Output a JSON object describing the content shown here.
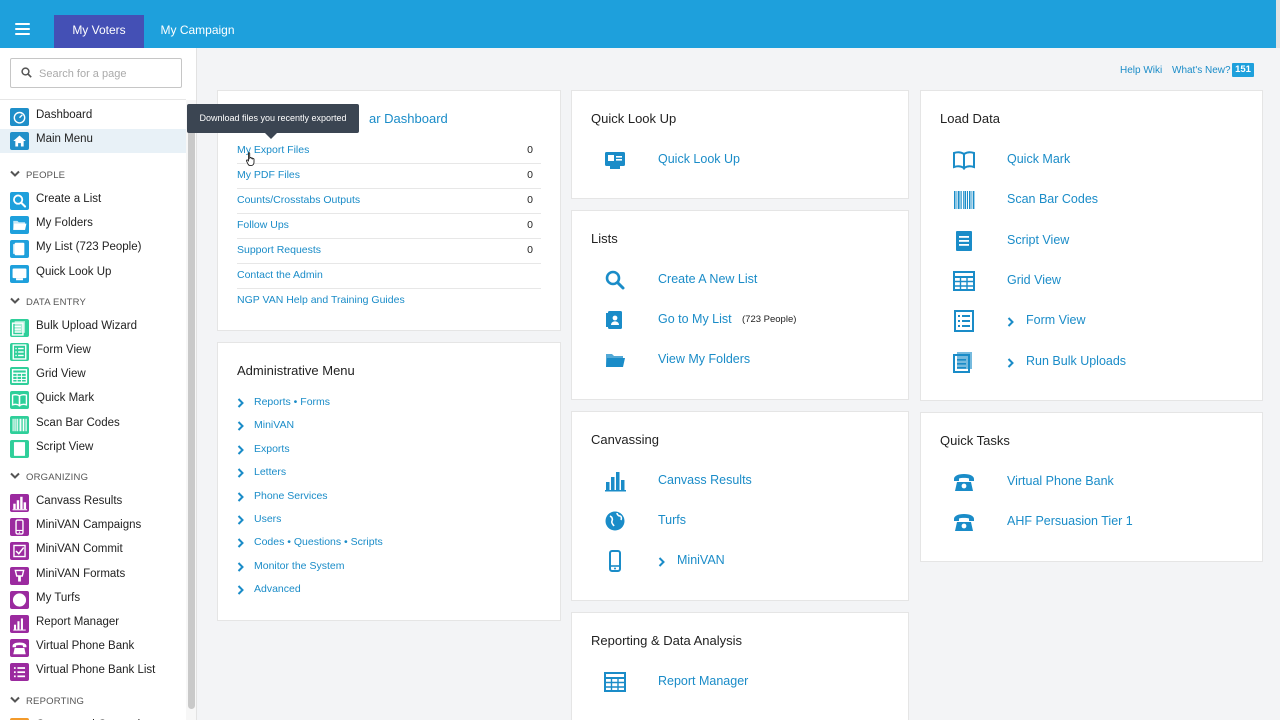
{
  "topbar": {
    "tabs": [
      {
        "label": "My Voters",
        "active": true
      },
      {
        "label": "My Campaign",
        "active": false
      }
    ],
    "colors": {
      "bar": "#1ea0dc",
      "active_tab": "#4450b5"
    }
  },
  "sidebar": {
    "search_placeholder": "Search for a page",
    "top_items": [
      {
        "label": "Dashboard",
        "icon": "dashboard-icon",
        "color": "#1f8fc9"
      },
      {
        "label": "Main Menu",
        "icon": "home-icon",
        "color": "#1f8fc9",
        "selected": true
      }
    ],
    "sections": [
      {
        "title": "PEOPLE",
        "color": "#1ea0dc",
        "items": [
          {
            "label": "Create a List",
            "icon": "search-icon"
          },
          {
            "label": "My Folders",
            "icon": "folder-icon"
          },
          {
            "label": "My List (723 People)",
            "icon": "contact-list-icon"
          },
          {
            "label": "Quick Look Up",
            "icon": "id-card-icon"
          }
        ]
      },
      {
        "title": "DATA ENTRY",
        "color": "#2fcf9a",
        "items": [
          {
            "label": "Bulk Upload Wizard",
            "icon": "bulk-upload-icon"
          },
          {
            "label": "Form View",
            "icon": "form-icon"
          },
          {
            "label": "Grid View",
            "icon": "grid-icon"
          },
          {
            "label": "Quick Mark",
            "icon": "book-icon"
          },
          {
            "label": "Scan Bar Codes",
            "icon": "barcode-icon"
          },
          {
            "label": "Script View",
            "icon": "script-icon"
          }
        ]
      },
      {
        "title": "ORGANIZING",
        "color": "#9b2a9f",
        "items": [
          {
            "label": "Canvass Results",
            "icon": "bar-chart-icon"
          },
          {
            "label": "MiniVAN Campaigns",
            "icon": "phone-device-icon"
          },
          {
            "label": "MiniVAN Commit",
            "icon": "checkbox-icon"
          },
          {
            "label": "MiniVAN Formats",
            "icon": "format-icon"
          },
          {
            "label": "My Turfs",
            "icon": "globe-icon"
          },
          {
            "label": "Report Manager",
            "icon": "report-icon"
          },
          {
            "label": "Virtual Phone Bank",
            "icon": "telephone-icon"
          },
          {
            "label": "Virtual Phone Bank List",
            "icon": "list-icon"
          }
        ]
      },
      {
        "title": "REPORTING",
        "color": "#f39a2a",
        "items": [
          {
            "label": "Counts and Crosstabs",
            "icon": "counts-icon"
          }
        ]
      }
    ]
  },
  "help": {
    "wiki": "Help Wiki",
    "whats_new": "What's New?",
    "badge": "151"
  },
  "dashboard": {
    "title_tail": "ar Dashboard",
    "tooltip": "Download files you recently exported",
    "rows": [
      {
        "label": "My Export Files",
        "count": "0"
      },
      {
        "label": "My PDF Files",
        "count": "0"
      },
      {
        "label": "Counts/Crosstabs Outputs",
        "count": "0"
      },
      {
        "label": "Follow Ups",
        "count": "0"
      },
      {
        "label": "Support Requests",
        "count": "0"
      },
      {
        "label": "Contact the Admin",
        "count": ""
      },
      {
        "label": "NGP VAN Help and Training Guides",
        "count": ""
      }
    ]
  },
  "admin": {
    "title": "Administrative Menu",
    "links": [
      "Reports • Forms",
      "MiniVAN",
      "Exports",
      "Letters",
      "Phone Services",
      "Users",
      "Codes • Questions • Scripts",
      "Monitor the System",
      "Advanced"
    ]
  },
  "quick_lookup": {
    "title": "Quick Look Up",
    "actions": [
      {
        "label": "Quick Look Up",
        "icon": "id-card-icon"
      }
    ]
  },
  "lists": {
    "title": "Lists",
    "actions": [
      {
        "label": "Create A New List",
        "icon": "search-icon"
      },
      {
        "label": "Go to My List",
        "icon": "contact-list-icon",
        "note": "(723 People)"
      },
      {
        "label": "View My Folders",
        "icon": "folder-icon"
      }
    ]
  },
  "canvassing": {
    "title": "Canvassing",
    "actions": [
      {
        "label": "Canvass Results",
        "icon": "bar-chart-icon"
      },
      {
        "label": "Turfs",
        "icon": "globe-icon"
      },
      {
        "label": "MiniVAN",
        "icon": "phone-device-icon",
        "chevron": true
      }
    ]
  },
  "reporting": {
    "title": "Reporting & Data Analysis",
    "actions": [
      {
        "label": "Report Manager",
        "icon": "grid-icon"
      }
    ]
  },
  "load_data": {
    "title": "Load Data",
    "actions": [
      {
        "label": "Quick Mark",
        "icon": "book-icon"
      },
      {
        "label": "Scan Bar Codes",
        "icon": "barcode-icon"
      },
      {
        "label": "Script View",
        "icon": "script-icon"
      },
      {
        "label": "Grid View",
        "icon": "grid-icon"
      },
      {
        "label": "Form View",
        "icon": "form-icon",
        "chevron": true
      },
      {
        "label": "Run Bulk Uploads",
        "icon": "bulk-upload-icon",
        "chevron": true
      }
    ]
  },
  "quick_tasks": {
    "title": "Quick Tasks",
    "actions": [
      {
        "label": "Virtual Phone Bank",
        "icon": "telephone-icon"
      },
      {
        "label": "AHF Persuasion Tier 1",
        "icon": "telephone-icon"
      }
    ]
  },
  "accent": "#1a8cc8"
}
